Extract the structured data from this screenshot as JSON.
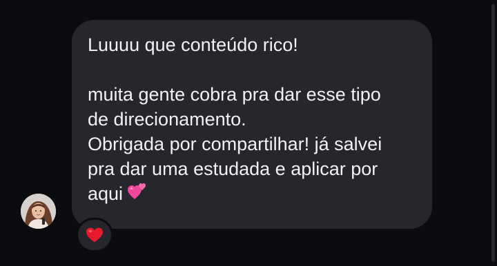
{
  "message": {
    "lines": [
      "Luuuu que conteúdo rico!",
      "",
      "muita gente cobra pra dar esse tipo",
      "de direcionamento.",
      "Obrigada por compartilhar! já salvei",
      "pra dar uma estudada e aplicar por",
      "aqui"
    ],
    "trailing_emoji": "two-hearts-emoji"
  },
  "reaction": {
    "emoji": "red-heart-emoji"
  },
  "sender": {
    "avatar": "profile-photo"
  },
  "colors": {
    "background": "#0b0c0f",
    "bubble": "#26272d",
    "text": "#f2f2f4",
    "heart": "#e8192c",
    "pink_heart": "#f0479a"
  }
}
